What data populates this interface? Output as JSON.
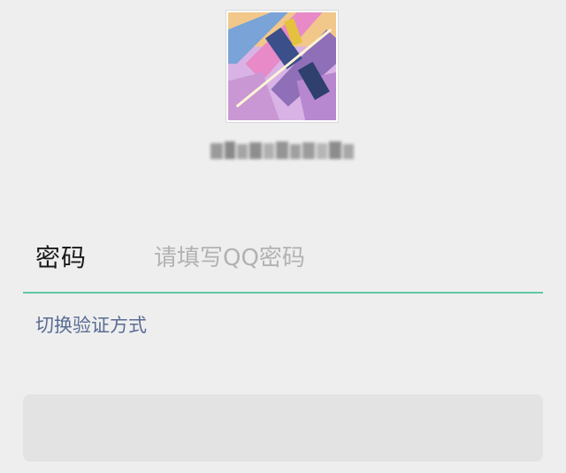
{
  "avatar": {
    "icon": "user-avatar-image"
  },
  "account": {
    "id_masked": ""
  },
  "password": {
    "label": "密码",
    "placeholder": "请填写QQ密码",
    "value": ""
  },
  "switch_verification": {
    "label": "切换验证方式"
  },
  "login_button": {
    "label": ""
  },
  "colors": {
    "underline_active": "#5fc9a3",
    "link": "#5a6c94",
    "background": "#eeeeee",
    "button_disabled": "#e3e3e3"
  }
}
